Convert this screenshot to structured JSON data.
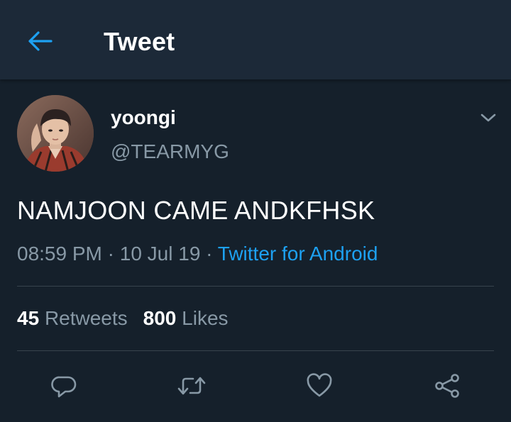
{
  "header": {
    "title": "Tweet",
    "back_icon": "arrow-left-icon"
  },
  "colors": {
    "background": "#15202b",
    "header_background": "#1c2938",
    "accent": "#1da1f2",
    "secondary_text": "#8899a6",
    "divider": "#38444d"
  },
  "tweet": {
    "author": {
      "display_name": "yoongi",
      "handle": "@TEARMYG"
    },
    "text": "NAMJOON CAME ANDKFHSK",
    "time": "08:59 PM",
    "separator": "·",
    "date": "10 Jul 19",
    "source": "Twitter for Android"
  },
  "stats": {
    "retweets_count": "45",
    "retweets_label": "Retweets",
    "likes_count": "800",
    "likes_label": "Likes"
  },
  "actions": [
    {
      "name": "reply",
      "icon": "reply-icon"
    },
    {
      "name": "retweet",
      "icon": "retweet-icon"
    },
    {
      "name": "like",
      "icon": "heart-icon"
    },
    {
      "name": "share",
      "icon": "share-icon"
    }
  ]
}
